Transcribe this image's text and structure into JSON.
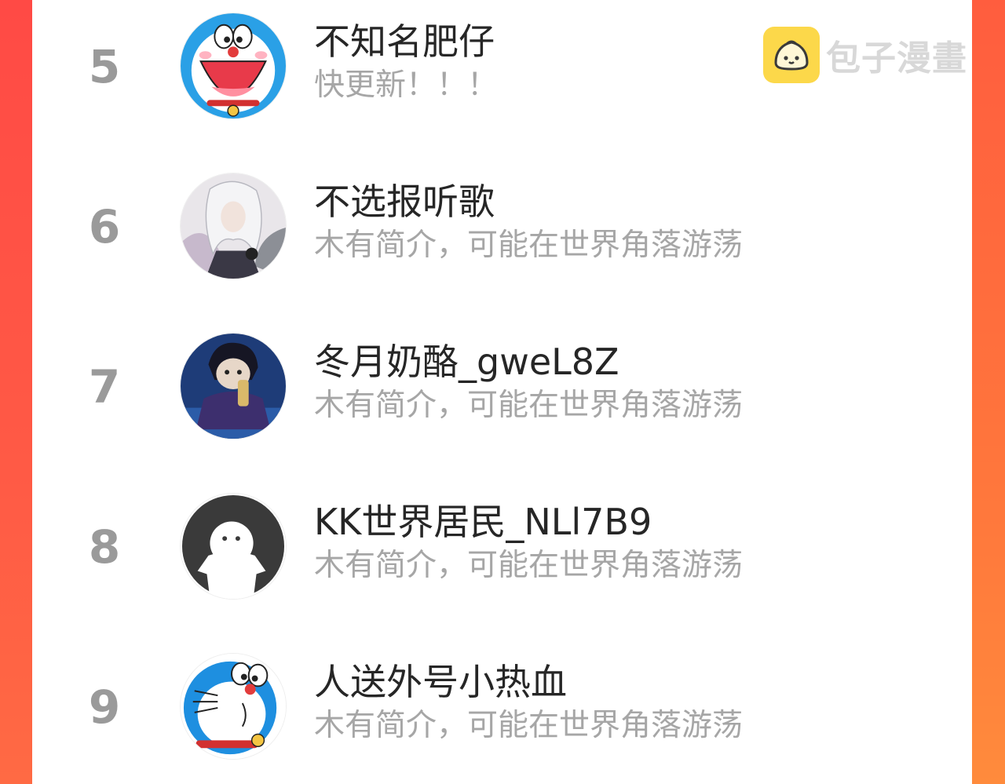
{
  "watermark": {
    "text": "包子漫畫",
    "icon": "bun-icon"
  },
  "colors": {
    "accent_left": "#ff4a45",
    "accent_right": "#ff7a3c",
    "rank_gray": "#9a9a9a",
    "name": "#262626",
    "bio": "#a6a6a6"
  },
  "users": [
    {
      "rank": "5",
      "name": "不知名肥仔",
      "bio": "快更新！！！",
      "avatar": "doraemon-face-avatar"
    },
    {
      "rank": "6",
      "name": "不选报听歌",
      "bio": "木有简介，可能在世界角落游荡",
      "avatar": "anime-white-hair-avatar"
    },
    {
      "rank": "7",
      "name": "冬月奶酪_gweL8Z",
      "bio": "木有简介，可能在世界角落游荡",
      "avatar": "anime-dark-character-avatar"
    },
    {
      "rank": "8",
      "name": "KK世界居民_NLl7B9",
      "bio": "木有简介，可能在世界角落游荡",
      "avatar": "default-ghost-avatar"
    },
    {
      "rank": "9",
      "name": "人送外号小热血",
      "bio": "木有简介，可能在世界角落游荡",
      "avatar": "doraemon-avatar"
    }
  ]
}
